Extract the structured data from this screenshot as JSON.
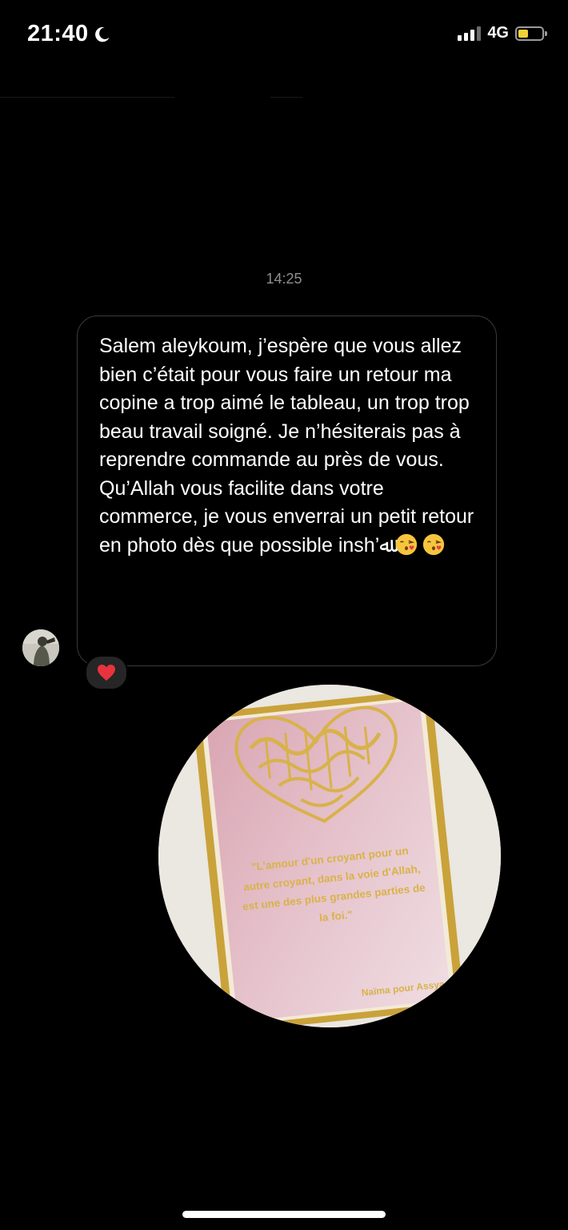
{
  "status_bar": {
    "time": "21:40",
    "network": "4G",
    "battery_color": "#f2d13a"
  },
  "conversation": {
    "timestamp": "14:25",
    "message": {
      "text": "Salem aleykoum, j’espère que vous allez bien c’était pour vous faire un retour ma copine a trop aimé le tableau, un trop trop beau travail soigné. Je n’hésiterais pas à reprendre commande au près de vous.\nQu’Allah vous facilite dans votre commerce, je vous enverrai un petit retour en photo dès que possible insh’ﷲ",
      "emojis": [
        "face-blowing-kiss-icon",
        "face-blowing-kiss-icon"
      ],
      "reaction": "heart-icon"
    },
    "photo": {
      "quote_lines": [
        "\"L'amour d'un croyant pour un",
        "autre croyant, dans la voie d'Allah,",
        "est une des plus grandes parties de",
        "la foi.\""
      ],
      "signature": "Naïma pour Assya",
      "frame_color": "#c9a23a",
      "background_color": "#e8c7cf"
    }
  }
}
